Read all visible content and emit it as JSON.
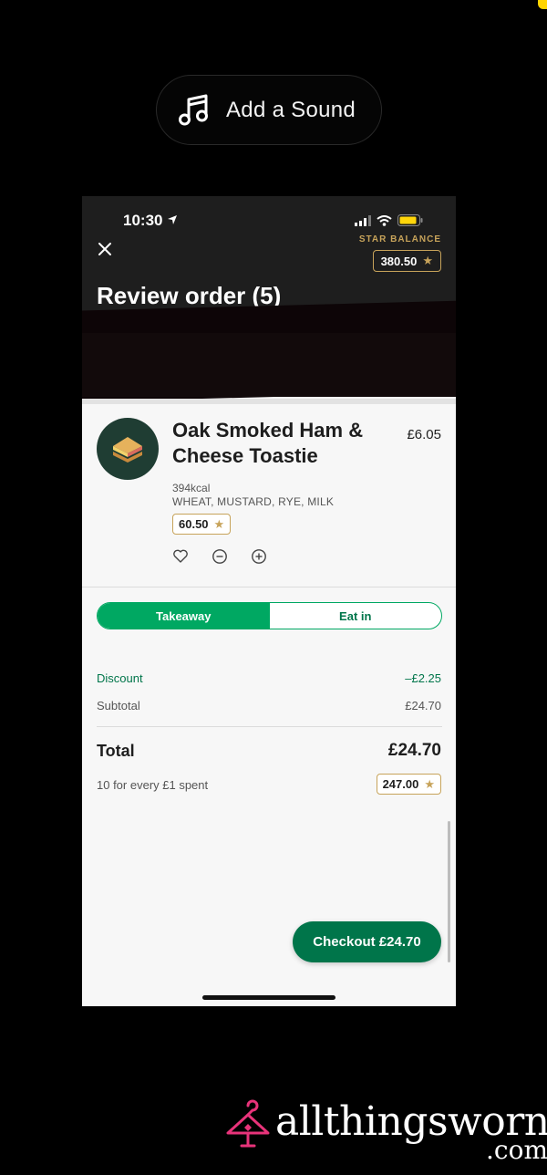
{
  "overlay": {
    "add_sound_label": "Add a Sound"
  },
  "status_bar": {
    "time": "10:30"
  },
  "header": {
    "star_balance_label": "STAR BALANCE",
    "star_balance_value": "380.50",
    "title": "Review order (5)"
  },
  "item": {
    "name": "Oak Smoked Ham & Cheese Toastie",
    "price": "£6.05",
    "calories": "394kcal",
    "allergens": "WHEAT, MUSTARD, RYE, MILK",
    "stars": "60.50"
  },
  "order_mode": {
    "options": [
      "Takeaway",
      "Eat in"
    ],
    "selected": "Takeaway"
  },
  "summary": {
    "discount_label": "Discount",
    "discount_value": "–£2.25",
    "subtotal_label": "Subtotal",
    "subtotal_value": "£24.70",
    "total_label": "Total",
    "total_value": "£24.70",
    "earn_label": "10 for every £1 spent",
    "earn_stars": "247.00"
  },
  "checkout": {
    "label": "Checkout £24.70"
  },
  "watermark": {
    "text": "allthingsworn",
    "suffix": ".com"
  },
  "colors": {
    "brand_green": "#00754a",
    "accent_green": "#00a862",
    "gold": "#c7a35a",
    "header_bg": "#1e1e1e",
    "watermark_pink": "#e8337a"
  }
}
